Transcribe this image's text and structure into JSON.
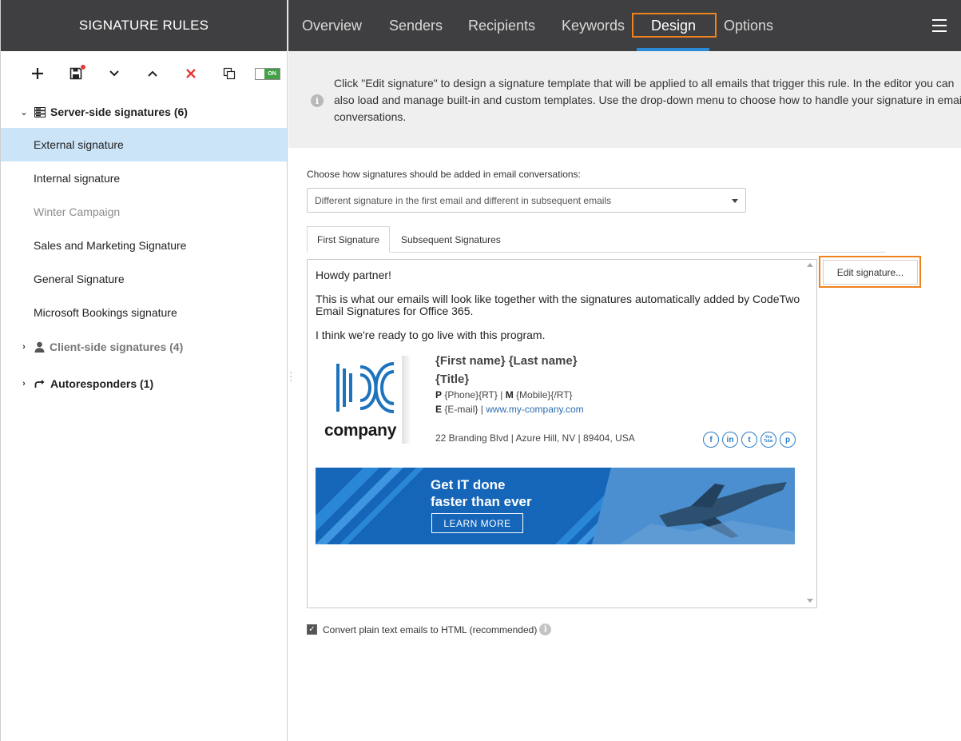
{
  "sidebar": {
    "title": "SIGNATURE RULES",
    "toolbar": {
      "toggle_label": "ON"
    },
    "groups": [
      {
        "label": "Server-side signatures (6)"
      },
      {
        "label": "Client-side signatures (4)"
      },
      {
        "label": "Autoresponders (1)"
      }
    ],
    "items": [
      {
        "label": "External signature"
      },
      {
        "label": "Internal signature"
      },
      {
        "label": "Winter Campaign"
      },
      {
        "label": "Sales and Marketing Signature"
      },
      {
        "label": "General Signature"
      },
      {
        "label": "Microsoft Bookings signature"
      }
    ]
  },
  "tabs": [
    {
      "label": "Overview"
    },
    {
      "label": "Senders"
    },
    {
      "label": "Recipients"
    },
    {
      "label": "Keywords"
    },
    {
      "label": "Design"
    },
    {
      "label": "Options"
    }
  ],
  "info": {
    "text": "Click \"Edit signature\" to design a signature template that will be applied to all emails that trigger this rule. In the editor you can also load and manage built-in and custom templates. Use the drop-down menu to choose how to handle your signature in email conversations."
  },
  "conversation": {
    "label": "Choose how signatures should be added in email conversations:",
    "selected": "Different signature in the first email and different in subsequent emails"
  },
  "subtabs": [
    {
      "label": "First Signature"
    },
    {
      "label": "Subsequent Signatures"
    }
  ],
  "preview": {
    "greeting": "Howdy partner!",
    "para1_line1": "This is what our emails will look like together with the signatures automatically added by CodeTwo",
    "para1_line2": "Email Signatures for Office 365.",
    "para2": "I think we're ready to go live with this program.",
    "logo_text": "company",
    "name": "{First name} {Last name}",
    "title": "{Title}",
    "phone_label": "P",
    "phone_value": "{Phone}{RT}",
    "mobile_label": "M",
    "mobile_value": "{Mobile}{/RT}",
    "email_label": "E",
    "email_value": "{E-mail}",
    "website": "www.my-company.com",
    "address": "22 Branding Blvd | Azure Hill, NV | 89404, USA",
    "socials": [
      "f",
      "in",
      "t",
      "You Tube",
      "p"
    ],
    "banner_line1": "Get IT done",
    "banner_line2": "faster than ever",
    "banner_button": "LEARN MORE"
  },
  "edit_button": "Edit signature...",
  "convert_checkbox": {
    "label": "Convert plain text emails to HTML (recommended)",
    "checked": true
  },
  "colors": {
    "accent": "#2b8ad6",
    "highlight": "#f0821e",
    "header_bg": "#3f3f41",
    "selected_row": "#cce4f7"
  }
}
